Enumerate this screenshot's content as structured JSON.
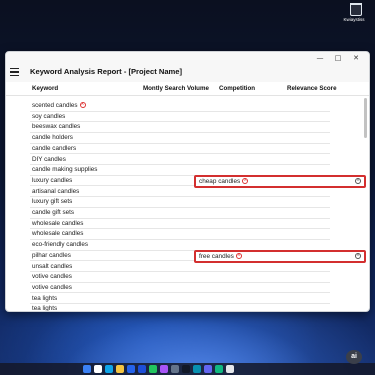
{
  "desktop": {
    "icon_label": "Kwiaystiss"
  },
  "window": {
    "controls": {
      "minimize": "—",
      "maximize": "□",
      "close": "✕"
    },
    "title": "Keyword Analysis Report - [Project Name]",
    "columns": [
      "Keyword",
      "Montly Search Volume",
      "Competition",
      "Relevance Score"
    ],
    "rows": [
      {
        "keyword": "scented candles",
        "removable": true
      },
      {
        "keyword": "soy candles",
        "removable": false
      },
      {
        "keyword": "beeswax candles",
        "removable": false
      },
      {
        "keyword": "candle holders",
        "removable": false
      },
      {
        "keyword": "candle candlers",
        "removable": false
      },
      {
        "keyword": "DIY candles",
        "removable": false
      },
      {
        "keyword": "candle making supplies",
        "removable": false
      },
      {
        "keyword": "luxury candles",
        "removable": false
      },
      {
        "keyword": "artisanal candles",
        "removable": false
      },
      {
        "keyword": "luxury gift sets",
        "removable": false
      },
      {
        "keyword": "candle gift sets",
        "removable": false
      },
      {
        "keyword": "wholesale candles",
        "removable": false
      },
      {
        "keyword": "wholesale candles",
        "removable": false
      },
      {
        "keyword": "eco-friendly candles",
        "removable": false
      },
      {
        "keyword": "pilhar candles",
        "removable": false
      },
      {
        "keyword": "unsalt candles",
        "removable": false
      },
      {
        "keyword": "votive candles",
        "removable": false
      },
      {
        "keyword": "votive candles",
        "removable": false
      },
      {
        "keyword": "tea lights",
        "removable": false
      },
      {
        "keyword": "tea lights",
        "removable": false
      }
    ],
    "competition_fields": [
      {
        "value": "cheap candles",
        "row_index": 7
      },
      {
        "value": "free candles",
        "row_index": 14
      }
    ]
  },
  "taskbar": {
    "icons": [
      "start-icon",
      "search-icon",
      "edge-icon",
      "explorer-icon",
      "store-icon",
      "mail-icon",
      "chrome-icon",
      "app-icon",
      "settings-icon",
      "terminal-icon",
      "photos-icon",
      "teams-icon",
      "media-icon",
      "misc-icon"
    ],
    "icon_colors": [
      "#3b82f6",
      "#ffffff",
      "#0ea5e9",
      "#f5c542",
      "#2563eb",
      "#1d4ed8",
      "#22c55e",
      "#a855f7",
      "#64748b",
      "#111827",
      "#0891b2",
      "#6366f1",
      "#10b981",
      "#e5e7eb"
    ]
  },
  "assistant_badge": "ai"
}
